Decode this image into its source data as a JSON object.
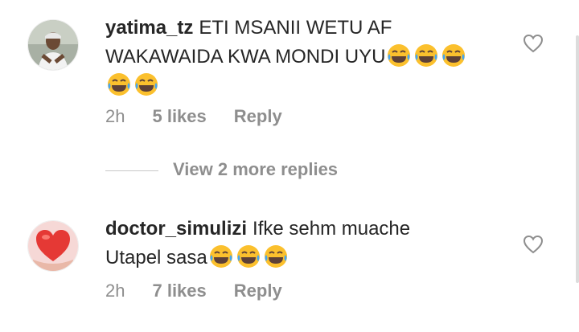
{
  "comments": [
    {
      "username": "yatima_tz",
      "text_line1": "ETI MSANII WETU AF",
      "text_line2": "WAKAWAIDA KWA MONDI UYU",
      "time": "2h",
      "likes": "5 likes",
      "reply": "Reply",
      "avatar_icon": "user-photo",
      "emoji_icon": "face-with-tears-of-joy-icon"
    },
    {
      "username": "doctor_simulizi",
      "text_line1": "Ifke sehm muache",
      "text_line2": "Utapel sasa",
      "time": "2h",
      "likes": "7 likes",
      "reply": "Reply",
      "avatar_icon": "red-heart-photo",
      "emoji_icon": "face-with-tears-of-joy-icon"
    }
  ],
  "view_more": "View 2 more replies",
  "colors": {
    "text": "#262626",
    "secondary": "#8e8e8e",
    "emoji_yellow": "#fbc02d",
    "emoji_tear": "#42a5f5",
    "heart_red": "#e53935"
  }
}
